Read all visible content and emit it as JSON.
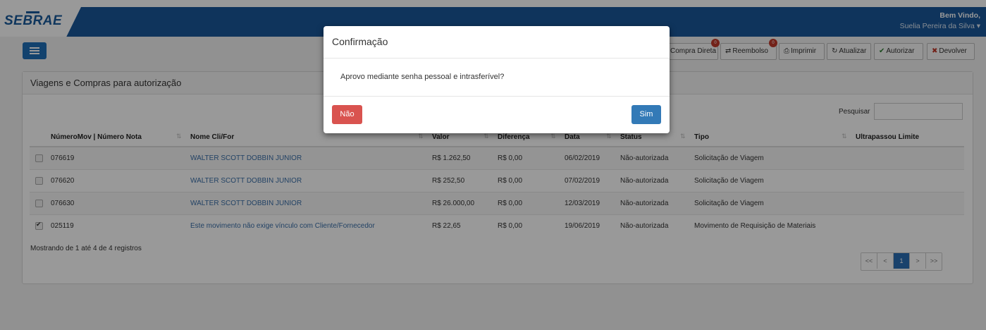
{
  "header": {
    "logo_text": "SEBRAE",
    "welcome_line1": "Bem Vindo,",
    "welcome_line2": "Suelia Pereira da Silva ▾"
  },
  "toolbar": {
    "buttons": [
      {
        "label": "Compra Direta",
        "badge": "0"
      },
      {
        "label": "Reembolso",
        "badge": "0",
        "icon": "exchange-icon"
      },
      {
        "label": "Imprimir",
        "icon": "print-icon"
      },
      {
        "label": "Atualizar",
        "icon": "refresh-icon"
      },
      {
        "label": "Autorizar",
        "icon": "check-icon"
      },
      {
        "label": "Devolver",
        "icon": "times-icon"
      }
    ]
  },
  "panel": {
    "title": "Viagens e Compras para autorização",
    "search_label": "Pesquisar",
    "search_value": "",
    "columns": [
      "NúmeroMov | Número Nota",
      "Nome Cli/For",
      "Valor",
      "Diferença",
      "Data",
      "Status",
      "Tipo",
      "Ultrapassou Limite"
    ],
    "rows": [
      {
        "checked": false,
        "numero": "076619",
        "nome": "WALTER SCOTT DOBBIN JUNIOR",
        "valor": "R$ 1.262,50",
        "diferenca": "R$ 0,00",
        "data": "06/02/2019",
        "status": "Não-autorizada",
        "tipo": "Solicitação de Viagem",
        "limite": ""
      },
      {
        "checked": false,
        "numero": "076620",
        "nome": "WALTER SCOTT DOBBIN JUNIOR",
        "valor": "R$ 252,50",
        "diferenca": "R$ 0,00",
        "data": "07/02/2019",
        "status": "Não-autorizada",
        "tipo": "Solicitação de Viagem",
        "limite": ""
      },
      {
        "checked": false,
        "numero": "076630",
        "nome": "WALTER SCOTT DOBBIN JUNIOR",
        "valor": "R$ 26.000,00",
        "diferenca": "R$ 0,00",
        "data": "12/03/2019",
        "status": "Não-autorizada",
        "tipo": "Solicitação de Viagem",
        "limite": ""
      },
      {
        "checked": true,
        "numero": "025119",
        "nome": "Este movimento não exige vínculo com Cliente/Fornecedor",
        "valor": "R$ 22,65",
        "diferenca": "R$ 0,00",
        "data": "19/06/2019",
        "status": "Não-autorizada",
        "tipo": "Movimento de Requisição de Materiais",
        "limite": ""
      }
    ],
    "footer_info": "Mostrando de 1 até 4 de 4 registros",
    "pager": [
      "<<",
      "<",
      "1",
      ">",
      ">>"
    ]
  },
  "modal": {
    "title": "Confirmação",
    "message": "Aprovo mediante senha pessoal e intrasferível?",
    "no_label": "Não",
    "yes_label": "Sim"
  },
  "colors": {
    "header": "#19589a",
    "primary": "#337ab7",
    "danger": "#d9534f"
  }
}
